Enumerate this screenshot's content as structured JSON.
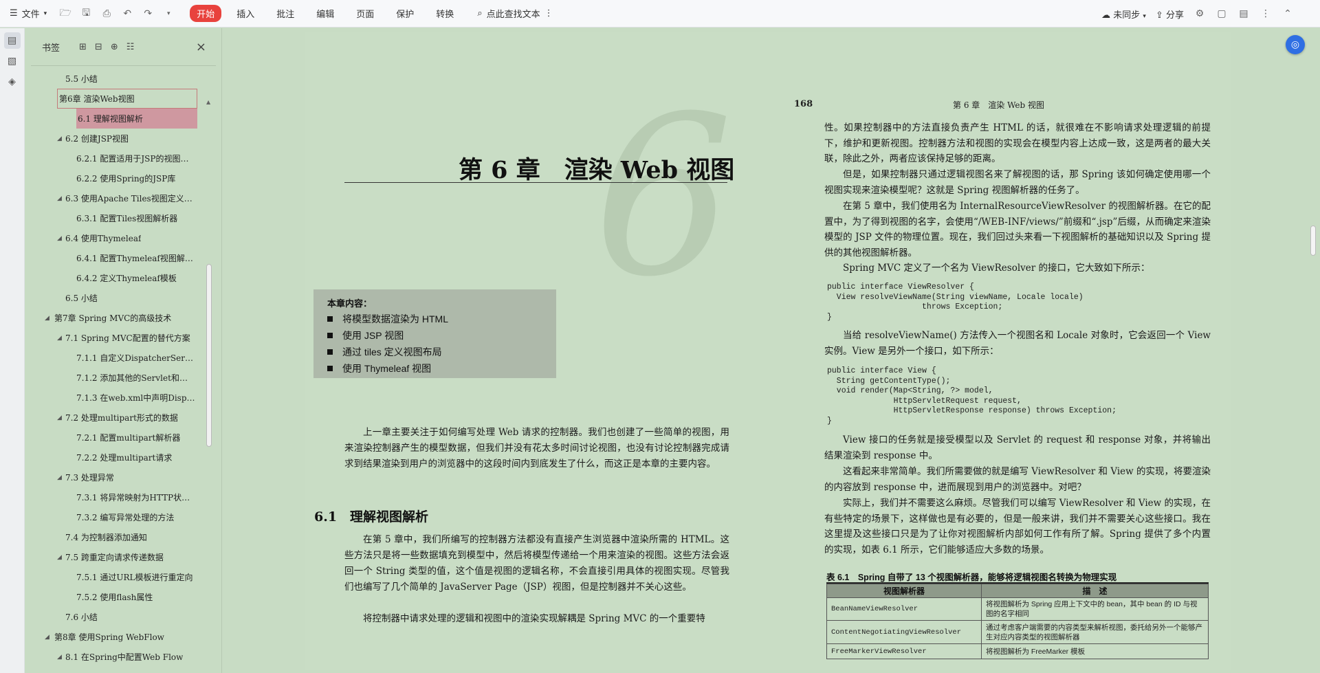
{
  "toolbar": {
    "file": "文件",
    "start": "开始",
    "menus": [
      "插入",
      "批注",
      "编辑",
      "页面",
      "保护",
      "转换"
    ],
    "search": "点此查找文本",
    "sync": "未同步",
    "share": "分享"
  },
  "bookmarks": {
    "title": "书签",
    "items": [
      {
        "label": "5.5 小结",
        "level": 2,
        "arrow": ""
      },
      {
        "label": "第6章 渲染Web视图",
        "level": 0,
        "arrow": "◢",
        "state": "outlined"
      },
      {
        "label": "6.1 理解视图解析",
        "level": 2,
        "arrow": "",
        "state": "selected"
      },
      {
        "label": "6.2 创建JSP视图",
        "level": 1,
        "arrow": "◢"
      },
      {
        "label": "6.2.1 配置适用于JSP的视图…",
        "level": 3,
        "arrow": ""
      },
      {
        "label": "6.2.2 使用Spring的JSP库",
        "level": 3,
        "arrow": ""
      },
      {
        "label": "6.3 使用Apache Tiles视图定义…",
        "level": 1,
        "arrow": "◢"
      },
      {
        "label": "6.3.1 配置Tiles视图解析器",
        "level": 3,
        "arrow": ""
      },
      {
        "label": "6.4 使用Thymeleaf",
        "level": 1,
        "arrow": "◢"
      },
      {
        "label": "6.4.1 配置Thymeleaf视图解…",
        "level": 3,
        "arrow": ""
      },
      {
        "label": "6.4.2 定义Thymeleaf模板",
        "level": 3,
        "arrow": ""
      },
      {
        "label": "6.5 小结",
        "level": 2,
        "arrow": ""
      },
      {
        "label": "第7章 Spring MVC的高级技术",
        "level": 0,
        "arrow": "◢"
      },
      {
        "label": "7.1 Spring MVC配置的替代方案",
        "level": 1,
        "arrow": "◢"
      },
      {
        "label": "7.1.1 自定义DispatcherSer…",
        "level": 3,
        "arrow": ""
      },
      {
        "label": "7.1.2 添加其他的Servlet和…",
        "level": 3,
        "arrow": ""
      },
      {
        "label": "7.1.3 在web.xml中声明Disp…",
        "level": 3,
        "arrow": ""
      },
      {
        "label": "7.2 处理multipart形式的数据",
        "level": 1,
        "arrow": "◢"
      },
      {
        "label": "7.2.1 配置multipart解析器",
        "level": 3,
        "arrow": ""
      },
      {
        "label": "7.2.2 处理multipart请求",
        "level": 3,
        "arrow": ""
      },
      {
        "label": "7.3 处理异常",
        "level": 1,
        "arrow": "◢"
      },
      {
        "label": "7.3.1 将异常映射为HTTP状…",
        "level": 3,
        "arrow": ""
      },
      {
        "label": "7.3.2 编写异常处理的方法",
        "level": 3,
        "arrow": ""
      },
      {
        "label": "7.4 为控制器添加通知",
        "level": 2,
        "arrow": ""
      },
      {
        "label": "7.5 跨重定向请求传递数据",
        "level": 1,
        "arrow": "◢"
      },
      {
        "label": "7.5.1 通过URL模板进行重定向",
        "level": 3,
        "arrow": ""
      },
      {
        "label": "7.5.2 使用flash属性",
        "level": 3,
        "arrow": ""
      },
      {
        "label": "7.6 小结",
        "level": 2,
        "arrow": ""
      },
      {
        "label": "第8章 使用Spring WebFlow",
        "level": 0,
        "arrow": "◢"
      },
      {
        "label": "8.1 在Spring中配置Web Flow",
        "level": 1,
        "arrow": "◢"
      }
    ]
  },
  "left_page": {
    "big_number": "6",
    "chapter_title": "第 6 章　渲染 Web 视图",
    "box_title": "本章内容：",
    "box_items": [
      "将模型数据渲染为 HTML",
      "使用 JSP 视图",
      "通过 tiles 定义视图布局",
      "使用 Thymeleaf 视图"
    ],
    "intro": "上一章主要关注于如何编写处理 Web 请求的控制器。我们也创建了一些简单的视图，用来渲染控制器产生的模型数据，但我们并没有花太多时间讨论视图，也没有讨论控制器完成请求到结果渲染到用户的浏览器中的这段时间内到底发生了什么，而这正是本章的主要内容。",
    "section": "6.1　理解视图解析",
    "para1": "在第 5 章中，我们所编写的控制器方法都没有直接产生浏览器中渲染所需的 HTML。这些方法只是将一些数据填充到模型中，然后将模型传递给一个用来渲染的视图。这些方法会返回一个 String 类型的值，这个值是视图的逻辑名称，不会直接引用具体的视图实现。尽管我们也编写了几个简单的 JavaServer Page（JSP）视图，但是控制器并不关心这些。",
    "para2": "将控制器中请求处理的逻辑和视图中的渲染实现解耦是 Spring MVC 的一个重要特"
  },
  "right_page": {
    "page_number": "168",
    "running_head": "第 6 章　渲染 Web 视图",
    "p1": "性。如果控制器中的方法直接负责产生 HTML 的话，就很难在不影响请求处理逻辑的前提下，维护和更新视图。控制器方法和视图的实现会在模型内容上达成一致，这是两者的最大关联，除此之外，两者应该保持足够的距离。",
    "p2": "但是，如果控制器只通过逻辑视图名来了解视图的话，那 Spring 该如何确定使用哪一个视图实现来渲染模型呢？这就是 Spring 视图解析器的任务了。",
    "p3": "在第 5 章中，我们使用名为 InternalResourceViewResolver 的视图解析器。在它的配置中，为了得到视图的名字，会使用“/WEB-INF/views/”前缀和“.jsp”后缀，从而确定来渲染模型的 JSP 文件的物理位置。现在，我们回过头来看一下视图解析的基础知识以及 Spring 提供的其他视图解析器。",
    "p4": "Spring MVC 定义了一个名为 ViewResolver 的接口，它大致如下所示：",
    "code1": "public interface ViewResolver {\n  View resolveViewName(String viewName, Locale locale)\n                    throws Exception;\n}",
    "p5": "当给 resolveViewName() 方法传入一个视图名和 Locale 对象时，它会返回一个 View 实例。View 是另外一个接口，如下所示：",
    "code2": "public interface View {\n  String getContentType();\n  void render(Map<String, ?> model,\n              HttpServletRequest request,\n              HttpServletResponse response) throws Exception;\n}",
    "p6": "View 接口的任务就是接受模型以及 Servlet 的 request 和 response 对象，并将输出结果渲染到 response 中。",
    "p7": "这看起来非常简单。我们所需要做的就是编写 ViewResolver 和 View 的实现，将要渲染的内容放到 response 中，进而展现到用户的浏览器中。对吧？",
    "p8": "实际上，我们并不需要这么麻烦。尽管我们可以编写 ViewResolver 和 View 的实现，在有些特定的场景下，这样做也是有必要的，但是一般来讲，我们并不需要关心这些接口。我在这里提及这些接口只是为了让你对视图解析内部如何工作有所了解。Spring 提供了多个内置的实现，如表 6.1 所示，它们能够适应大多数的场景。",
    "table_caption": "表 6.1　Spring 自带了 13 个视图解析器，能够将逻辑视图名转换为物理实现",
    "table_headers": [
      "视图解析器",
      "描　述"
    ],
    "table_rows": [
      [
        "BeanNameViewResolver",
        "将视图解析为 Spring 应用上下文中的 bean，其中 bean 的 ID 与视图的名字相同"
      ],
      [
        "ContentNegotiatingViewResolver",
        "通过考虑客户端需要的内容类型来解析视图，委托给另外一个能够产生对应内容类型的视图解析器"
      ],
      [
        "FreeMarkerViewResolver",
        "将视图解析为 FreeMarker 模板"
      ]
    ]
  },
  "colors": {
    "background": "#c8dcc4",
    "start_button": "#e8423d",
    "selected_bookmark": "#cf98a0",
    "float_button": "#2f6fe3"
  }
}
